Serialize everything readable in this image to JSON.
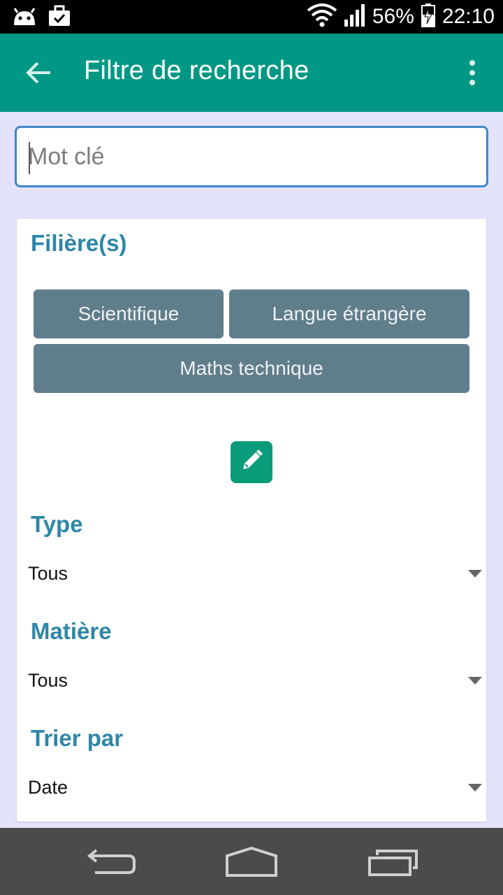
{
  "status_bar": {
    "battery": "56%",
    "time": "22:10",
    "icons": [
      "android-icon",
      "briefcase-check-icon",
      "wifi-icon",
      "signal-icon",
      "battery-charging-icon"
    ]
  },
  "app_bar": {
    "title": "Filtre de recherche",
    "back_icon": "arrow-back-icon",
    "menu_icon": "more-vert-icon"
  },
  "search": {
    "placeholder": "Mot clé",
    "value": ""
  },
  "filieres": {
    "title": "Filière(s)",
    "chips": [
      "Scientifique",
      "Langue étrangère",
      "Maths technique"
    ],
    "edit_icon": "pencil-icon"
  },
  "type": {
    "title": "Type",
    "selected": "Tous"
  },
  "matiere": {
    "title": "Matière",
    "selected": "Tous"
  },
  "sort": {
    "title": "Trier par",
    "selected": "Date"
  },
  "colors": {
    "app_bar": "#009884",
    "accent_title": "#2E86A8",
    "chip": "#607D8B",
    "edit_button": "#0A9B7A",
    "background": "#E3E4FB"
  },
  "nav_bar": {
    "icons": [
      "back-nav-icon",
      "home-nav-icon",
      "recents-nav-icon"
    ]
  }
}
